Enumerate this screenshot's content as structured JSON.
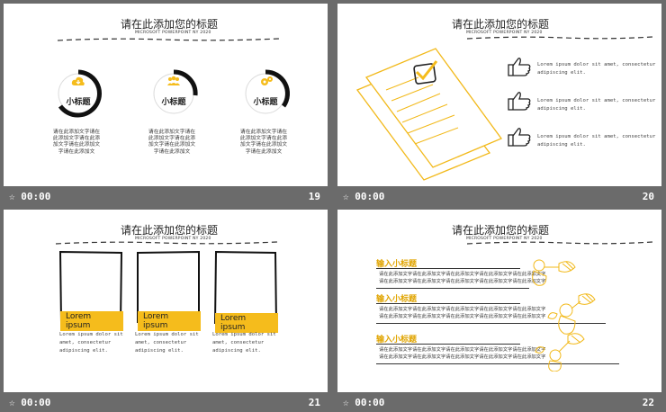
{
  "slides": [
    {
      "id": "19",
      "title": "请在此添加您的标题",
      "subtitle": "MICROSOFT POWERPOINT NY 2020",
      "time": "00:00",
      "number": "19",
      "items": [
        {
          "label": "小标题",
          "icon": "cloud-download-icon",
          "text": [
            "请在此添加文字请在",
            "此添加文字请在此添",
            "加文字请在此添加文",
            "字请在此添加文"
          ]
        },
        {
          "label": "小标题",
          "icon": "people-icon",
          "text": [
            "请在此添加文字请在",
            "此添加文字请在此添",
            "加文字请在此添加文",
            "字请在此添加文"
          ]
        },
        {
          "label": "小标题",
          "icon": "gears-icon",
          "text": [
            "请在此添加文字请在",
            "此添加文字请在此添",
            "加文字请在此添加文",
            "字请在此添加文"
          ]
        }
      ]
    },
    {
      "id": "20",
      "title": "请在此添加您的标题",
      "subtitle": "MICROSOFT POWERPOINT NY 2020",
      "time": "00:00",
      "number": "20",
      "items": [
        {
          "icon": "thumbs-up-icon",
          "text": [
            "Lorem ipsum dolor sit amet, consectetur",
            "adipiscing elit."
          ]
        },
        {
          "icon": "thumbs-up-icon",
          "text": [
            "Lorem ipsum dolor sit amet, consectetur",
            "adipiscing elit."
          ]
        },
        {
          "icon": "thumbs-up-icon",
          "text": [
            "Lorem ipsum dolor sit amet, consectetur",
            "adipiscing elit."
          ]
        }
      ]
    },
    {
      "id": "21",
      "title": "请在此添加您的标题",
      "subtitle": "MICROSOFT POWERPOINT NY 2020",
      "time": "00:00",
      "number": "21",
      "items": [
        {
          "tag": "Lorem ipsum",
          "text": [
            "Lorem ipsum dolor sit",
            "amet, consectetur",
            "adipiscing elit."
          ]
        },
        {
          "tag": "Lorem ipsum",
          "text": [
            "Lorem ipsum dolor sit",
            "amet, consectetur",
            "adipiscing elit."
          ]
        },
        {
          "tag": "Lorem ipsum",
          "text": [
            "Lorem ipsum dolor sit",
            "amet, consectetur",
            "adipiscing elit."
          ]
        }
      ]
    },
    {
      "id": "22",
      "title": "请在此添加您的标题",
      "subtitle": "MICROSOFT POWERPOINT NY 2020",
      "time": "00:00",
      "number": "22",
      "items": [
        {
          "label": "输入小标题",
          "text": [
            "请在此添加文字请在此添加文字请在此添加文字请在此添加文字请在此添加文字",
            "请在此添加文字请在此添加文字请在此添加文字请在此添加文字请在此添加文字"
          ]
        },
        {
          "label": "输入小标题",
          "text": [
            "请在此添加文字请在此添加文字请在此添加文字请在此添加文字请在此添加文字",
            "请在此添加文字请在此添加文字请在此添加文字请在此添加文字请在此添加文字"
          ]
        },
        {
          "label": "输入小标题",
          "text": [
            "请在此添加文字请在此添加文字请在此添加文字请在此添加文字请在此添加文字",
            "请在此添加文字请在此添加文字请在此添加文字请在此添加文字请在此添加文字"
          ]
        }
      ]
    }
  ],
  "colors": {
    "accent": "#f5bc1c",
    "background": "#6b6b6b",
    "slide": "#ffffff"
  },
  "status_icon": "slide-transition-icon"
}
